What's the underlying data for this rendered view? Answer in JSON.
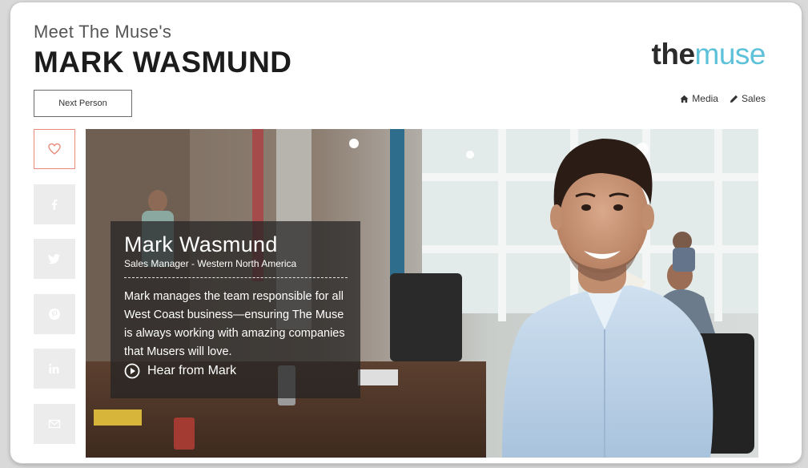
{
  "header": {
    "eyebrow": "Meet The Muse's",
    "name": "MARK WASMUND",
    "logo": {
      "the": "the",
      "muse": "muse"
    },
    "next_button": "Next Person",
    "tags": [
      {
        "icon": "home-icon",
        "label": "Media"
      },
      {
        "icon": "pencil-icon",
        "label": "Sales"
      }
    ]
  },
  "social": [
    {
      "icon": "heart-icon"
    },
    {
      "icon": "facebook-icon"
    },
    {
      "icon": "twitter-icon"
    },
    {
      "icon": "pinterest-icon"
    },
    {
      "icon": "linkedin-icon"
    },
    {
      "icon": "email-icon"
    }
  ],
  "profile": {
    "name": "Mark Wasmund",
    "role": "Sales Manager - Western North America",
    "bio": "Mark manages the team responsible for all West Coast business—ensuring The Muse is always working with amazing companies that Musers will love.",
    "hear_label": "Hear from Mark"
  },
  "colors": {
    "logo_accent": "#5cc1d9",
    "heart_border": "#e98a7c",
    "overlay_bg": "rgba(35,35,35,0.72)"
  }
}
